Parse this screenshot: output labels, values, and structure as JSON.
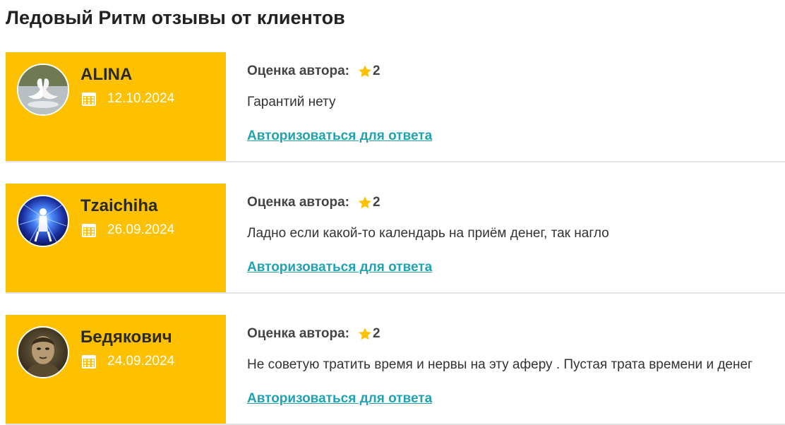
{
  "page": {
    "title": "Ледовый Ритм отзывы от клиентов"
  },
  "colors": {
    "panel": "#fdc102",
    "link": "#1fa3b0",
    "star": "#fdc102"
  },
  "reviews": [
    {
      "author": "ALINA",
      "date": "12.10.2024",
      "rating_label": "Оценка автора:",
      "rating": "2",
      "text": "Гарантий нету",
      "reply_label": "Авторизоваться для ответа",
      "avatar_icon": "swans-avatar"
    },
    {
      "author": "Tzaichiha",
      "date": "26.09.2024",
      "rating_label": "Оценка автора:",
      "rating": "2",
      "text": "Ладно если какой-то календарь на приём денег, так нагло",
      "reply_label": "Авторизоваться для ответа",
      "avatar_icon": "cosmic-figure-avatar"
    },
    {
      "author": "Бедякович",
      "date": "24.09.2024",
      "rating_label": "Оценка автора:",
      "rating": "2",
      "text": "Не советую тратить время и нервы на эту аферу . Пустая трата времени и денег",
      "reply_label": "Авторизоваться для ответа",
      "avatar_icon": "portrait-avatar"
    }
  ]
}
